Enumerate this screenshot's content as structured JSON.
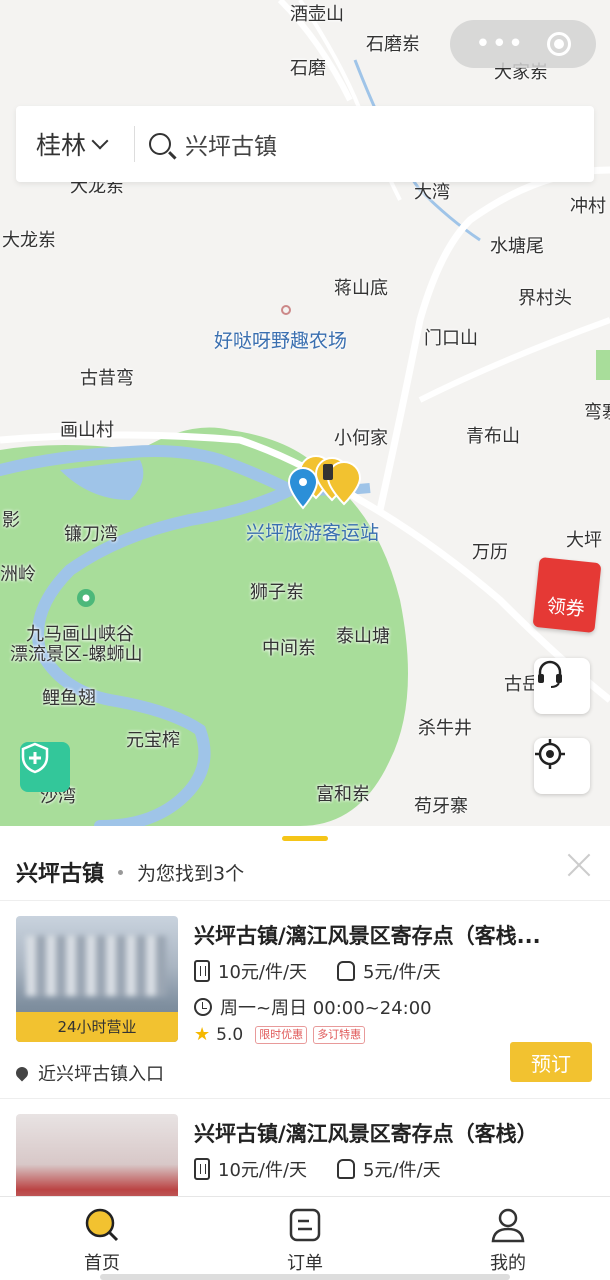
{
  "map": {
    "places": [
      {
        "name": "酒壶山",
        "cls": ""
      },
      {
        "name": "石磨岽",
        "cls": ""
      },
      {
        "name": "石磨",
        "cls": ""
      },
      {
        "name": "大家岽",
        "cls": ""
      },
      {
        "name": "大龙岽",
        "cls": ""
      },
      {
        "name": "大龙岽",
        "cls": ""
      },
      {
        "name": "大湾",
        "cls": ""
      },
      {
        "name": "冲村",
        "cls": ""
      },
      {
        "name": "水塘尾",
        "cls": ""
      },
      {
        "name": "蒋山底",
        "cls": ""
      },
      {
        "name": "界村头",
        "cls": ""
      },
      {
        "name": "好哒呀野趣农场",
        "cls": "blue"
      },
      {
        "name": "门口山",
        "cls": ""
      },
      {
        "name": "古昔弯",
        "cls": ""
      },
      {
        "name": "画山村",
        "cls": ""
      },
      {
        "name": "小何家",
        "cls": ""
      },
      {
        "name": "青布山",
        "cls": ""
      },
      {
        "name": "弯寨",
        "cls": ""
      },
      {
        "name": "兴坪旅游客运站",
        "cls": "blue"
      },
      {
        "name": "影",
        "cls": ""
      },
      {
        "name": "镰刀湾",
        "cls": ""
      },
      {
        "name": "万历",
        "cls": ""
      },
      {
        "name": "大坪",
        "cls": ""
      },
      {
        "name": "洲岭",
        "cls": ""
      },
      {
        "name": "狮子岽",
        "cls": ""
      },
      {
        "name": "九马画山峡谷",
        "cls": ""
      },
      {
        "name": "漂流景区-螺蛳山",
        "cls": ""
      },
      {
        "name": "中间岽",
        "cls": ""
      },
      {
        "name": "泰山塘",
        "cls": ""
      },
      {
        "name": "古岳",
        "cls": ""
      },
      {
        "name": "鲤鱼翅",
        "cls": ""
      },
      {
        "name": "杀牛井",
        "cls": ""
      },
      {
        "name": "元宝榨",
        "cls": ""
      },
      {
        "name": "沙湾",
        "cls": ""
      },
      {
        "name": "富和岽",
        "cls": ""
      },
      {
        "name": "苟牙寨",
        "cls": ""
      }
    ],
    "coupon_label": "领券"
  },
  "search": {
    "city": "桂林",
    "query": "兴坪古镇"
  },
  "results": {
    "title": "兴坪古镇",
    "found_text": "为您找到3个",
    "items": [
      {
        "name": "兴坪古镇/漓江风景区寄存点（客栈...",
        "price_luggage": "10元/件/天",
        "price_bag": "5元/件/天",
        "hours": "周一~周日 00:00~24:00",
        "rating": "5.0",
        "promos": [
          "限时优惠",
          "多订特惠"
        ],
        "badge": "24小时营业",
        "location": "近兴坪古镇入口",
        "book_label": "预订"
      },
      {
        "name": "兴坪古镇/漓江风景区寄存点（客栈）",
        "price_luggage": "10元/件/天",
        "price_bag": "5元/件/天"
      }
    ]
  },
  "tabs": [
    {
      "label": "首页",
      "icon": "search-home-icon",
      "active": true
    },
    {
      "label": "订单",
      "icon": "order-icon",
      "active": false
    },
    {
      "label": "我的",
      "icon": "user-icon",
      "active": false
    }
  ],
  "colors": {
    "accent": "#f2c230",
    "park": "#a8dd9a",
    "river": "#9fc4e8",
    "shield": "#33c79a",
    "coupon": "#e53935"
  }
}
